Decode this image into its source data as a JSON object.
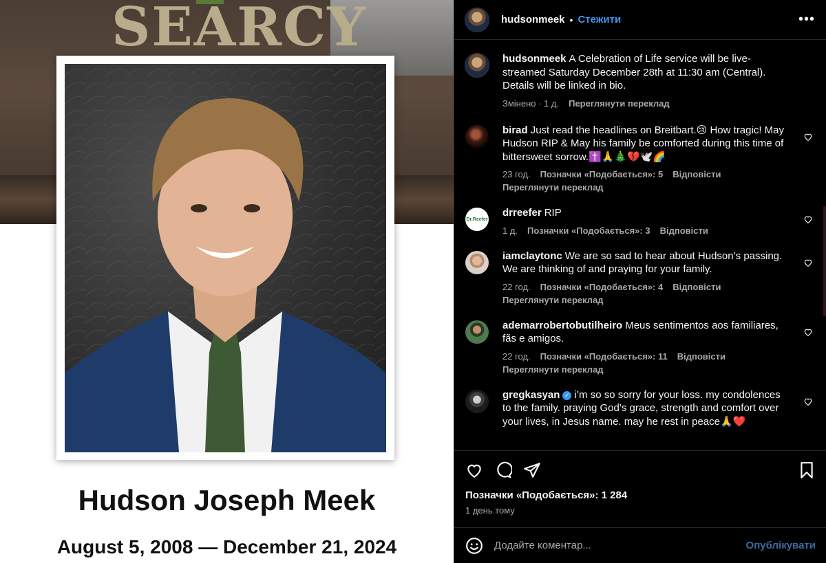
{
  "post_image": {
    "brand": "SEARCY",
    "full_name": "Hudson Joseph Meek",
    "dates": "August 5, 2008 — December 21, 2024"
  },
  "header": {
    "username": "hudsonmeek",
    "separator": "•",
    "follow_label": "Стежити",
    "more_label": "•••"
  },
  "caption": {
    "username": "hudsonmeek",
    "text": "A Celebration of Life service will be live-streamed Saturday December 28th at 11:30 am (Central). Details will be linked in bio.",
    "edited": "Змінено · 1 д.",
    "translate": "Переглянути переклад"
  },
  "comments": [
    {
      "username": "birad",
      "text": "Just read the headlines on Breitbart.😢 How tragic! May Hudson RIP & May his family be comforted during this time of bittersweet sorrow.✝️🙏🎄💔🕊️🌈",
      "time": "23 год.",
      "likes": "Позначки «Подобається»: 5",
      "reply": "Відповісти",
      "translate": "Переглянути переклад"
    },
    {
      "username": "drreefer",
      "avatar_text": "Dr.Reefer",
      "text": "RIP",
      "time": "1 д.",
      "likes": "Позначки «Подобається»: 3",
      "reply": "Відповісти"
    },
    {
      "username": "iamclaytonc",
      "text": "We are so sad to hear about Hudson’s passing. We are thinking of and praying for your family.",
      "time": "22 год.",
      "likes": "Позначки «Подобається»: 4",
      "reply": "Відповісти",
      "translate": "Переглянути переклад"
    },
    {
      "username": "ademarrobertobutilheiro",
      "text": "Meus sentimentos aos familiares, fãs e amigos.",
      "time": "22 год.",
      "likes": "Позначки «Подобається»: 11",
      "reply": "Відповісти",
      "translate": "Переглянути переклад"
    },
    {
      "username": "gregkasyan",
      "verified": "✓",
      "text": "i’m so so sorry for your loss. my condolences to the family. praying God’s grace, strength and comfort over your lives, in Jesus name. may he rest in peace🙏❤️"
    }
  ],
  "footer": {
    "likes": "Позначки «Подобається»: 1 284",
    "posted": "1 день тому",
    "comment_placeholder": "Додайте коментар...",
    "publish_label": "Опублікувати"
  },
  "colors": {
    "accent_blue": "#3897f0",
    "muted": "#a8a8a8",
    "background": "#000000"
  }
}
